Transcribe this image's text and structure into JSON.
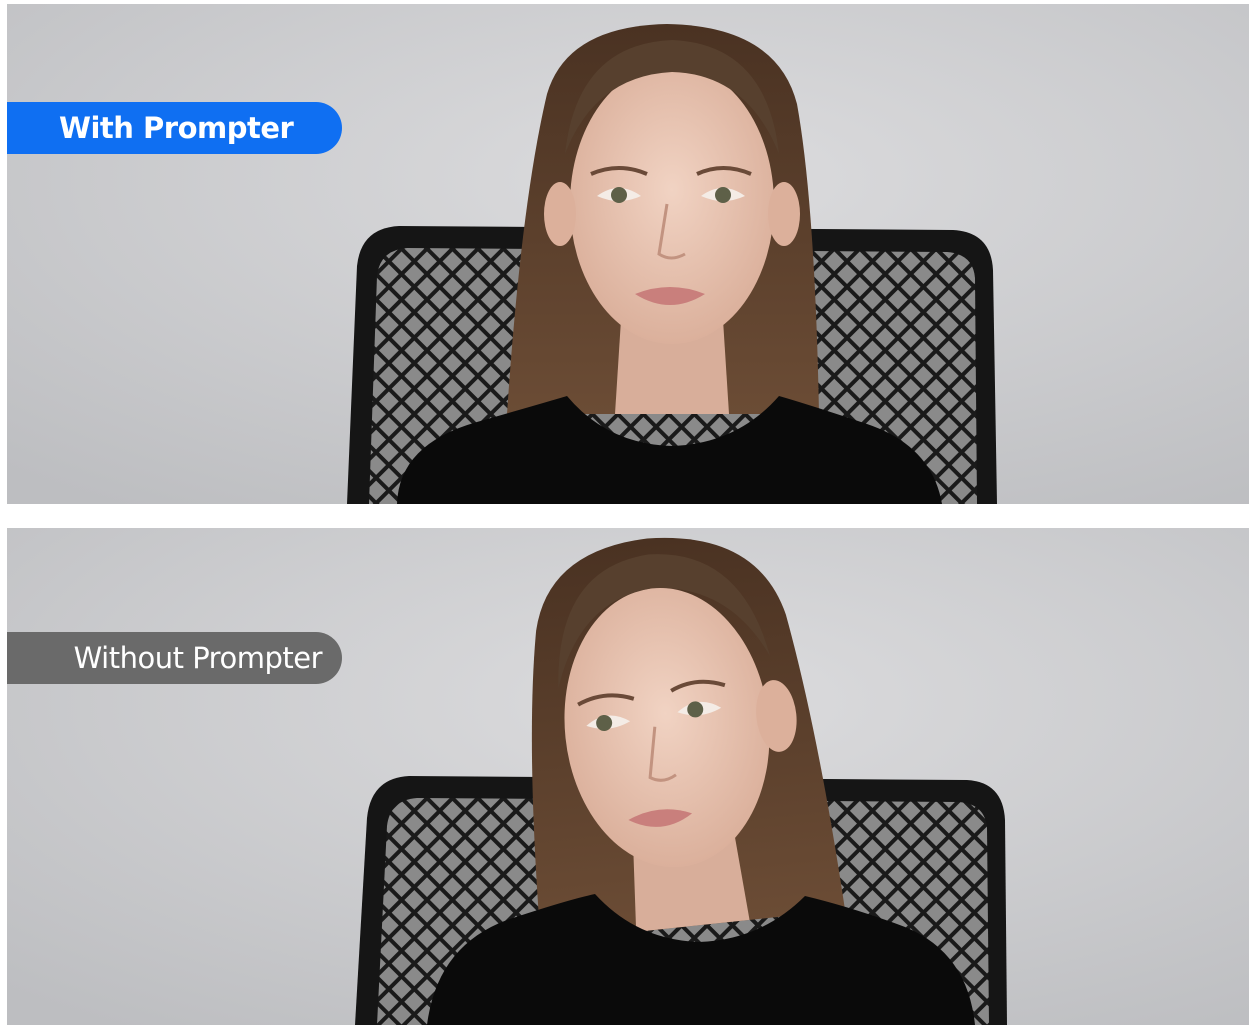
{
  "comparison": {
    "top_label": "With Prompter",
    "bottom_label": "Without Prompter"
  },
  "colors": {
    "with_badge": "#0f6ff2",
    "without_badge": "#6a6a6a",
    "backdrop": "#cfd0d2",
    "chair": "#151515",
    "shirt": "#0a0a0a",
    "hair": "#5a3f2c",
    "skin": "#e8c3b0"
  },
  "panels": [
    {
      "subject": "woman in black top seated in mesh office chair, looking at camera",
      "gaze": "direct"
    },
    {
      "subject": "woman in black top seated in mesh office chair, head tilted, looking off-camera",
      "gaze": "averted"
    }
  ]
}
